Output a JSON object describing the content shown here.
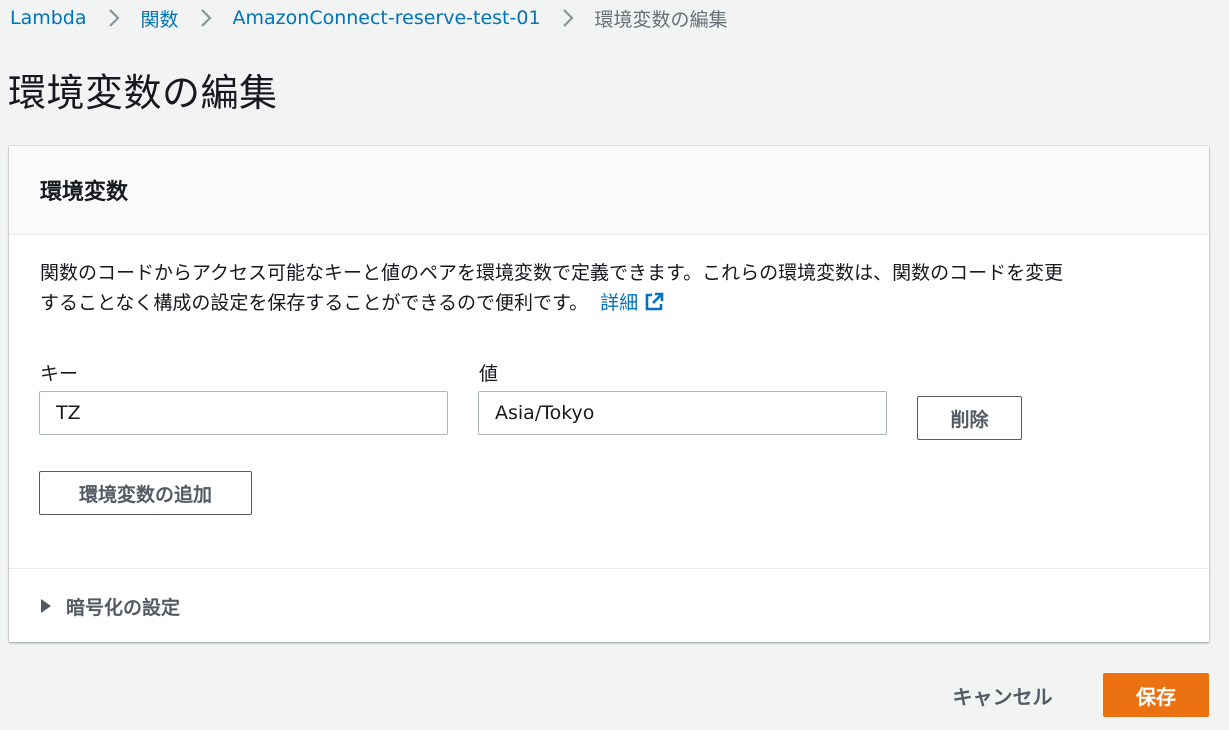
{
  "breadcrumb": {
    "items": [
      "Lambda",
      "関数",
      "AmazonConnect-reserve-test-01"
    ],
    "current": "環境変数の編集"
  },
  "page_title": "環境変数の編集",
  "panel": {
    "title": "環境変数",
    "description_line1": "関数のコードからアクセス可能なキーと値のペアを環境変数で定義できます。これらの環境変数は、関数のコードを変更",
    "description_line2": "することなく構成の設定を保存することができるので便利です。",
    "learn_more_label": "詳細",
    "key_label": "キー",
    "value_label": "値",
    "variables": [
      {
        "key": "TZ",
        "value": "Asia/Tokyo"
      }
    ],
    "remove_label": "削除",
    "add_label": "環境変数の追加",
    "encryption_label": "暗号化の設定"
  },
  "footer": {
    "cancel_label": "キャンセル",
    "save_label": "保存"
  },
  "colors": {
    "link": "#0073bb",
    "primary_button": "#ec7211",
    "background": "#f2f3f3"
  },
  "icons": [
    "chevron-right-icon",
    "external-link-icon",
    "caret-right-icon"
  ]
}
